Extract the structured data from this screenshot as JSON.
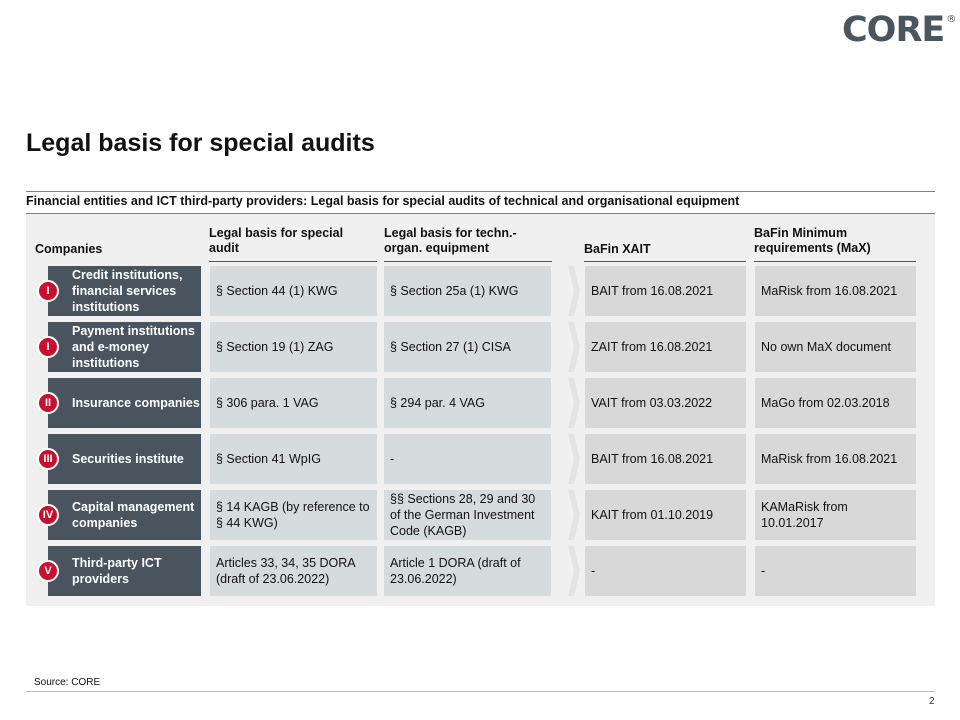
{
  "logo": {
    "text": "CORE",
    "mark": "®"
  },
  "title": "Legal basis for special audits",
  "subtitle": "Financial entities and ICT third-party providers: Legal basis for special audits of technical and organisational equipment",
  "headers": {
    "companies": "Companies",
    "legal_basis": "Legal basis for special audit",
    "techn": "Legal basis for techn.-organ. equipment",
    "xait": "BaFin XAIT",
    "max": "BaFin Minimum requirements (MaX)"
  },
  "rows": [
    {
      "badge": "I",
      "company": "Credit institutions, financial services institutions",
      "legal": "§ Section 44 (1) KWG",
      "tech": "§ Section 25a (1) KWG",
      "xait": "BAIT from 16.08.2021",
      "max": "MaRisk from 16.08.2021"
    },
    {
      "badge": "I",
      "company": "Payment institutions and e-money institutions",
      "legal": "§ Section 19 (1) ZAG",
      "tech": "§ Section 27 (1) CISA",
      "xait": "ZAIT from 16.08.2021",
      "max": "No own MaX document"
    },
    {
      "badge": "II",
      "company": "Insurance companies",
      "legal": "§ 306 para. 1 VAG",
      "tech": "§ 294 par. 4 VAG",
      "xait": "VAIT from 03.03.2022",
      "max": "MaGo from 02.03.2018"
    },
    {
      "badge": "III",
      "company": "Securities institute",
      "legal": "§ Section 41 WpIG",
      "tech": "-",
      "xait": "BAIT from 16.08.2021",
      "max": "MaRisk from 16.08.2021"
    },
    {
      "badge": "IV",
      "company": "Capital management companies",
      "legal": "§ 14 KAGB (by reference to § 44 KWG)",
      "tech": "§§ Sections 28, 29 and 30 of the German Investment Code (KAGB)",
      "xait": "KAIT from 01.10.2019",
      "max": "KAMaRisk from 10.01.2017"
    },
    {
      "badge": "V",
      "company": "Third-party ICT providers",
      "legal": "Articles 33, 34, 35 DORA (draft of 23.06.2022)",
      "tech": "Article 1 DORA (draft of 23.06.2022)",
      "xait": "-",
      "max": "-"
    }
  ],
  "footer": {
    "source": "Source: CORE",
    "page": "2"
  },
  "colors": {
    "company_bg": "#4a545e",
    "badge": "#c8102e",
    "cell_bg": "#d6dbde",
    "panel_bg": "#f0f0f0"
  }
}
